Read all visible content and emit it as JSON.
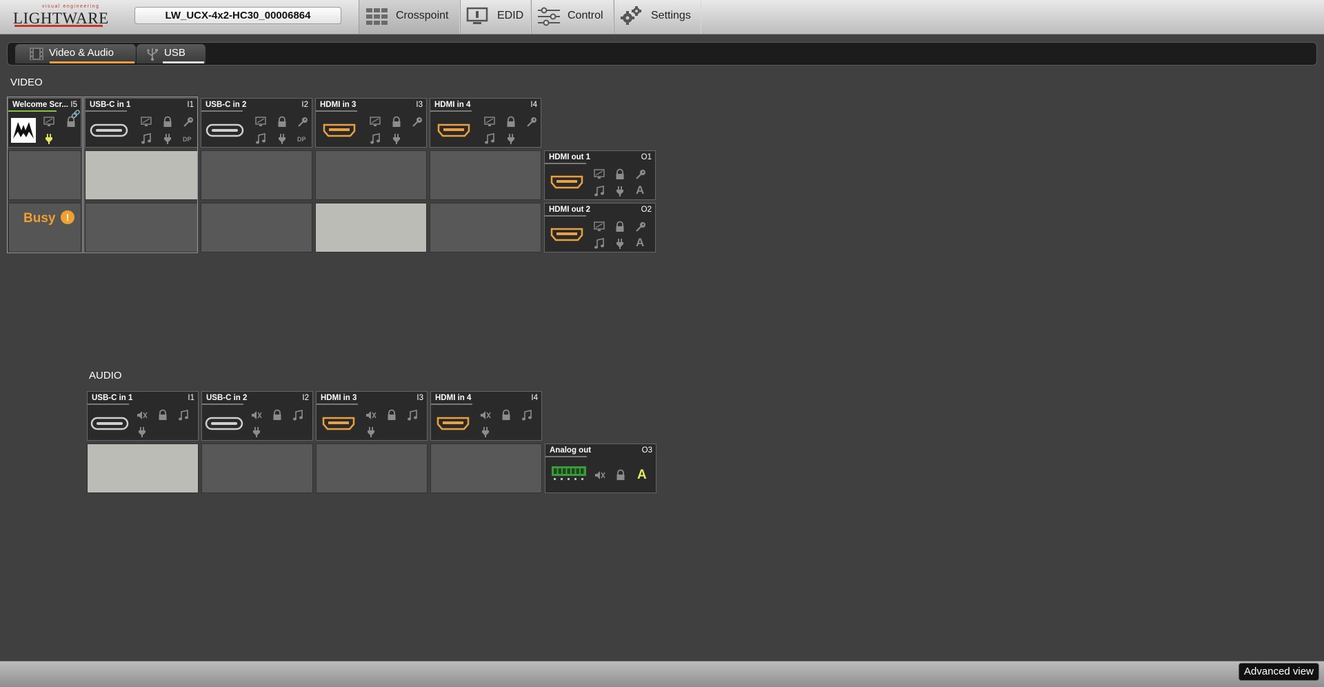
{
  "logo": {
    "tagline": "visual engineering",
    "wordmark": "LIGHTWARE"
  },
  "device_name": "LW_UCX-4x2-HC30_00006864",
  "nav": {
    "crosspoint": "Crosspoint",
    "edid": "EDID",
    "control": "Control",
    "settings": "Settings",
    "active": "Crosspoint"
  },
  "subtabs": {
    "video_audio": "Video & Audio",
    "usb": "USB",
    "active": "Video & Audio"
  },
  "video": {
    "title": "VIDEO",
    "inputs": [
      {
        "name": "Welcome Scr...",
        "id": "I5"
      },
      {
        "name": "USB-C in 1",
        "id": "I1"
      },
      {
        "name": "USB-C in 2",
        "id": "I2"
      },
      {
        "name": "HDMI in 3",
        "id": "I3"
      },
      {
        "name": "HDMI in 4",
        "id": "I4"
      }
    ],
    "outputs": [
      {
        "name": "HDMI out 1",
        "id": "O1"
      },
      {
        "name": "HDMI out 2",
        "id": "O2"
      }
    ],
    "busy_label": "Busy",
    "busy_mark": "!",
    "connected": {
      "O1": "I1",
      "O2": "I3"
    }
  },
  "audio": {
    "title": "AUDIO",
    "inputs": [
      {
        "name": "USB-C in 1",
        "id": "I1"
      },
      {
        "name": "USB-C in 2",
        "id": "I2"
      },
      {
        "name": "HDMI in 3",
        "id": "I3"
      },
      {
        "name": "HDMI in 4",
        "id": "I4"
      }
    ],
    "outputs": [
      {
        "name": "Analog out",
        "id": "O3",
        "indicator": "A"
      }
    ],
    "connected": {
      "O3": "I1"
    }
  },
  "icon_letters": {
    "dp": "DP",
    "autoselect": "A"
  },
  "advanced_view": "Advanced view",
  "colors": {
    "accent_orange": "#e8a040",
    "link_green": "#8bc34a",
    "indicator_yellow": "#e8e860",
    "brand_red": "#c0392b"
  }
}
